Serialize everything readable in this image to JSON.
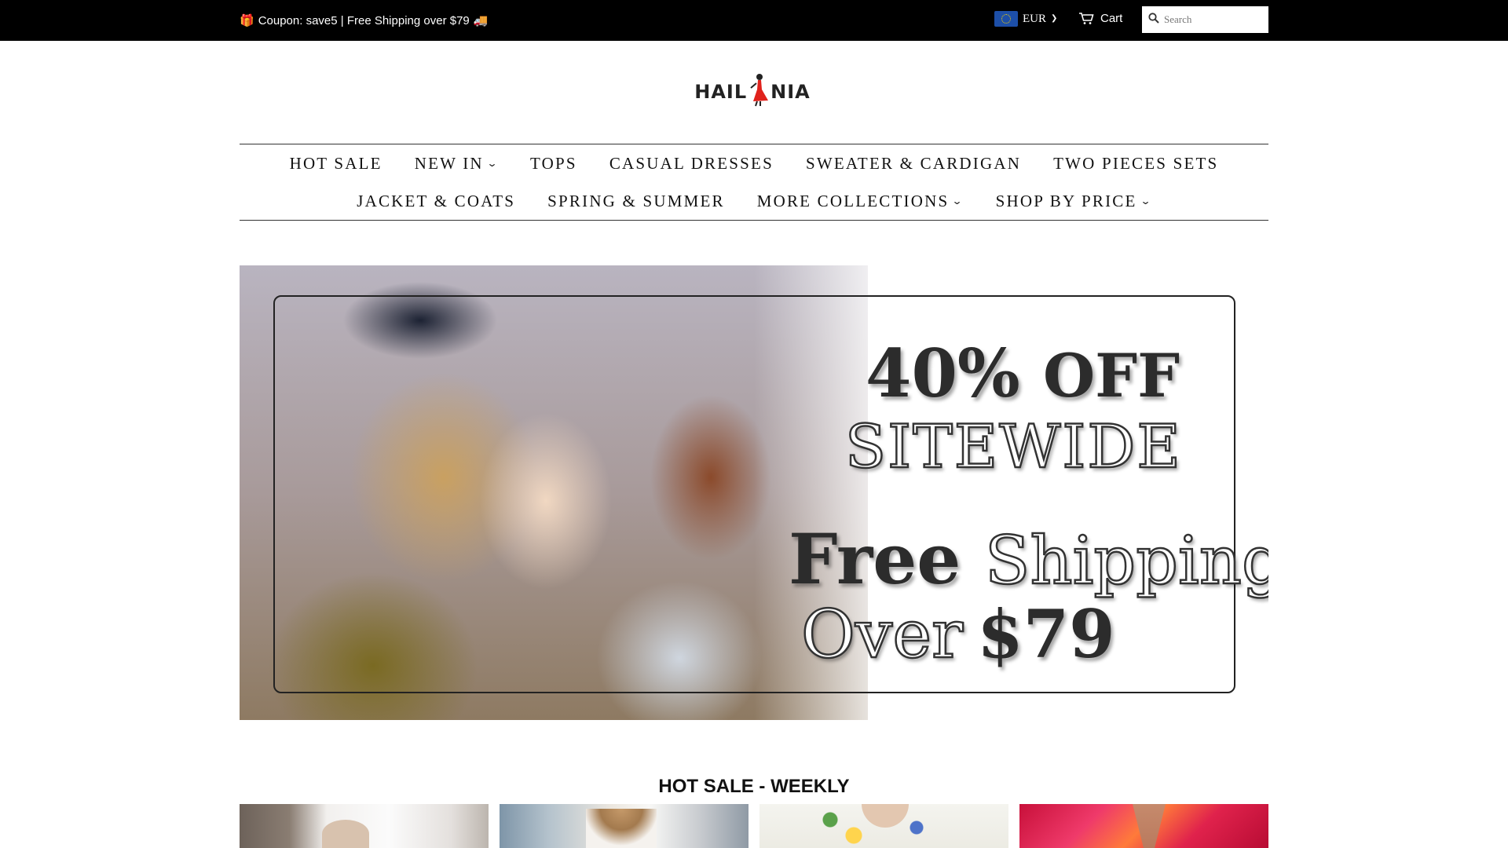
{
  "topbar": {
    "announcement": "Coupon: save5 | Free Shipping over $79",
    "gift_icon": "🎁",
    "truck_icon": "🚚",
    "currency": "EUR",
    "cart_label": "Cart",
    "search_placeholder": "Search",
    "colors": {
      "background": "#000000",
      "text": "#ffffff"
    }
  },
  "logo": {
    "left_text": "HAIL",
    "right_text": "NIA",
    "figure_color": "#e0221c"
  },
  "nav": {
    "row1": [
      {
        "label": "HOT SALE",
        "has_dropdown": false
      },
      {
        "label": "NEW IN",
        "has_dropdown": true
      },
      {
        "label": "TOPS",
        "has_dropdown": false
      },
      {
        "label": "CASUAL DRESSES",
        "has_dropdown": false
      },
      {
        "label": "SWEATER & CARDIGAN",
        "has_dropdown": false
      },
      {
        "label": "TWO PIECES SETS",
        "has_dropdown": false
      }
    ],
    "row2": [
      {
        "label": "JACKET & COATS",
        "has_dropdown": false
      },
      {
        "label": "SPRING & SUMMER",
        "has_dropdown": false
      },
      {
        "label": "MORE COLLECTIONS",
        "has_dropdown": true
      },
      {
        "label": "SHOP BY PRICE",
        "has_dropdown": true
      }
    ]
  },
  "hero": {
    "line1_percent": "40%",
    "line1_off": "OFF",
    "line2": "SITEWIDE",
    "line3_free": "Free",
    "line3_shipping": "Shipping",
    "line4_over": "Over",
    "line4_price": "$79"
  },
  "hot_sale": {
    "title": "HOT SALE - WEEKLY",
    "products": [
      "white-blouse",
      "white-ruffle-top",
      "floral-print-top",
      "pink-orange-print-shirt"
    ]
  }
}
